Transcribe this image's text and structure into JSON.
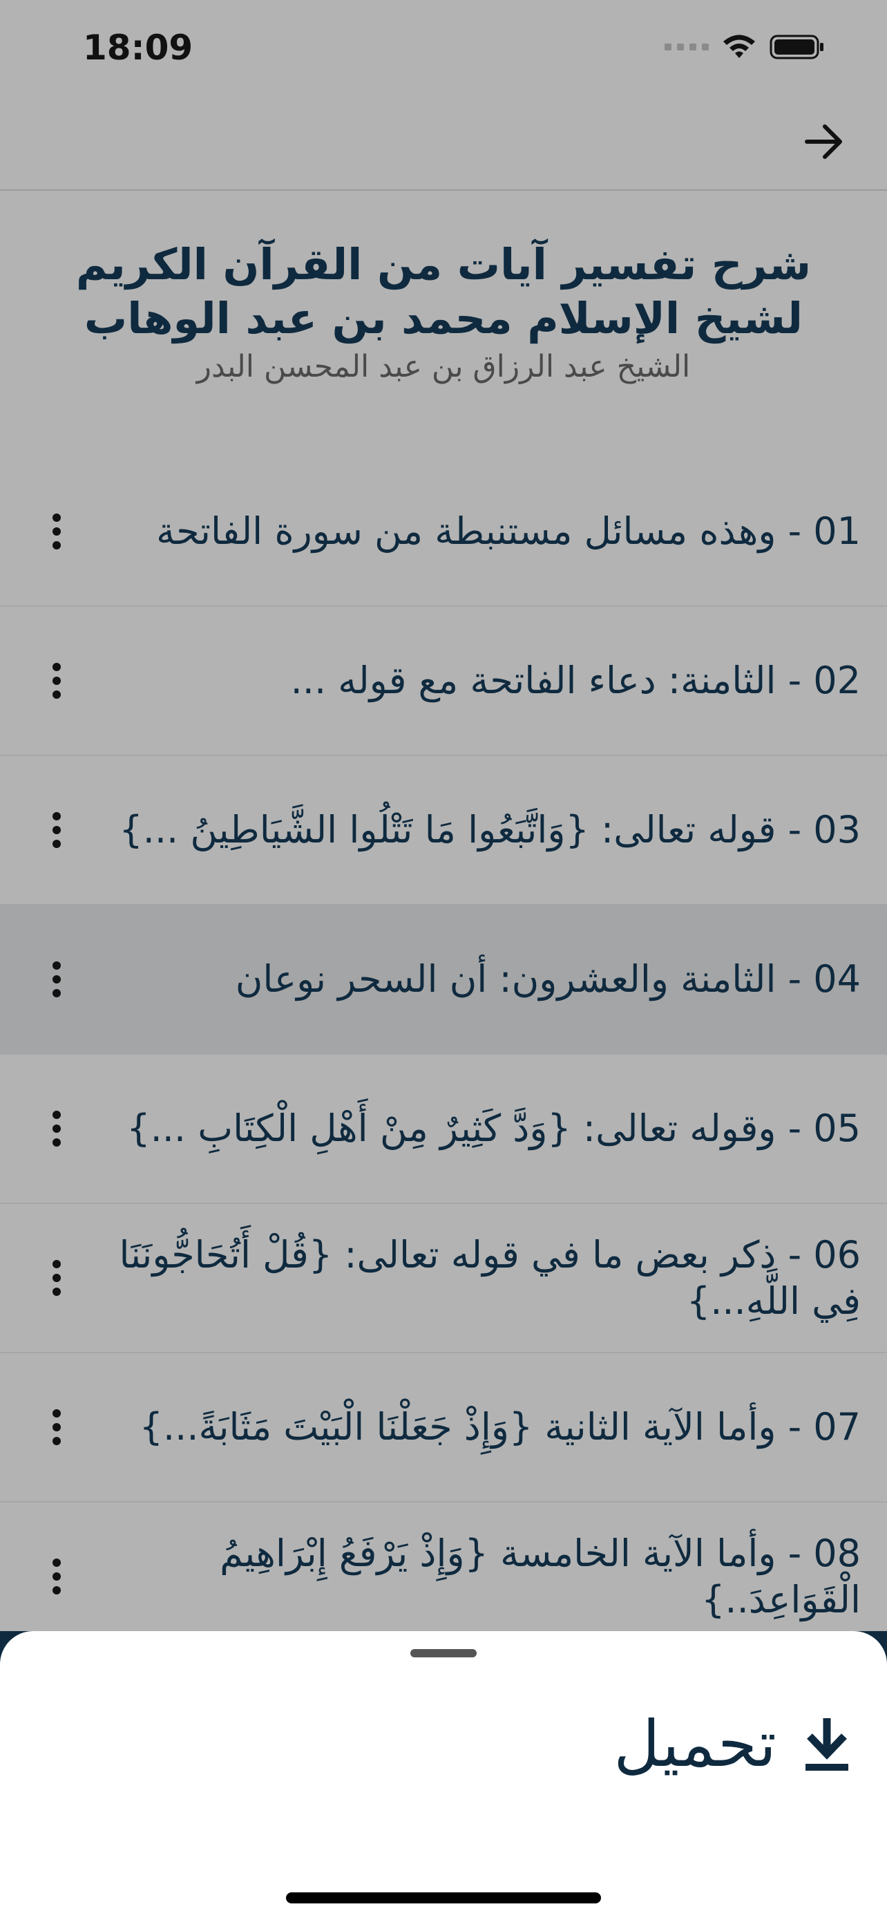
{
  "status_bar": {
    "time": "18:09"
  },
  "header": {
    "title": "شرح تفسير آيات من القرآن الكريم لشيخ الإسلام محمد بن عبد الوهاب",
    "subtitle": "الشيخ عبد الرزاق بن عبد المحسن البدر"
  },
  "lessons": [
    {
      "label": "01 - وهذه مسائل مستنبطة من سورة الفاتحة"
    },
    {
      "label": "02 - الثامنة: دعاء الفاتحة مع قوله ..."
    },
    {
      "label": "03 - قوله تعالى: {وَاتَّبَعُوا مَا تَتْلُوا الشَّيَاطِينُ ...}"
    },
    {
      "label": "04 - الثامنة والعشرون: أن السحر نوعان"
    },
    {
      "label": "05 - وقوله تعالى: {وَدَّ كَثِيرٌ مِنْ أَهْلِ الْكِتَابِ ...}"
    },
    {
      "label": "06 - ذكر بعض ما في قوله تعالى: {قُلْ أَتُحَاجُّونَنَا فِي اللَّهِ...}"
    },
    {
      "label": "07 - وأما الآية الثانية {وَإِذْ جَعَلْنَا الْبَيْتَ مَثَابَةً...}"
    },
    {
      "label": "08 - وأما الآية الخامسة {وَإِذْ يَرْفَعُ إِبْرَاهِيمُ الْقَوَاعِدَ..}"
    }
  ],
  "highlighted_index": 3,
  "sheet": {
    "download_label": "تحميل"
  },
  "colors": {
    "primary": "#0f2a3f",
    "overlay": "#b3b3b3",
    "highlight": "#a4a5a6"
  },
  "icons": {
    "back": "arrow-right-icon",
    "more": "more-vertical-icon",
    "download": "download-icon"
  }
}
